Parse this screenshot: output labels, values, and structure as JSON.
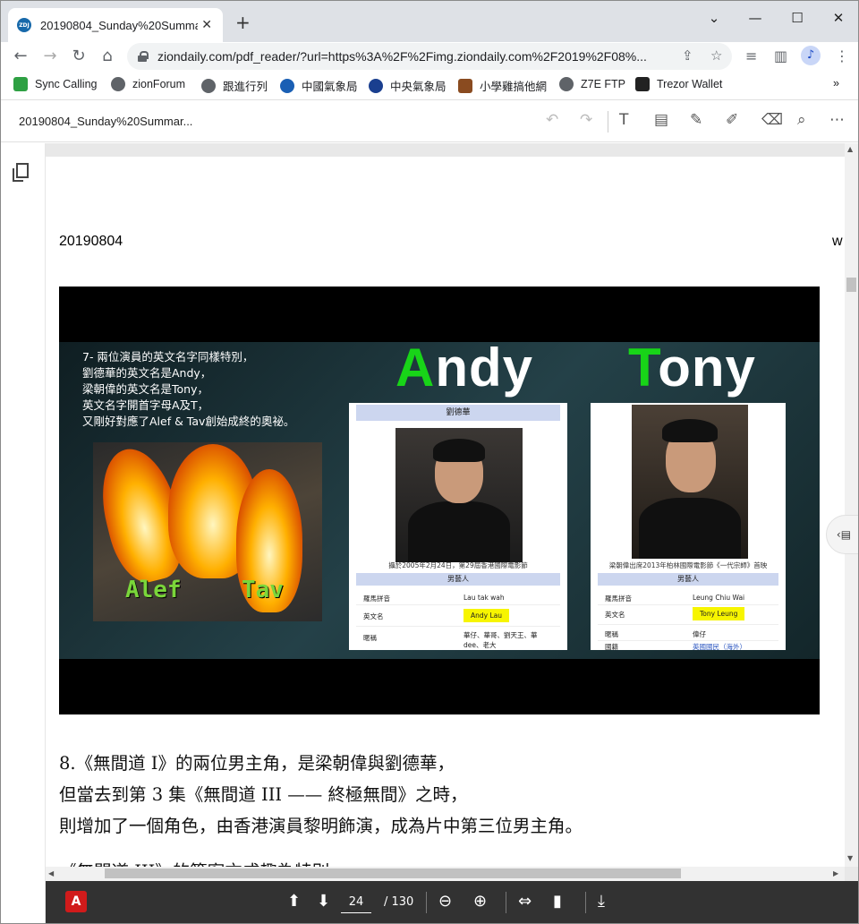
{
  "browser": {
    "tab_title": "20190804_Sunday%20Summar",
    "tab_favicon_text": "ZDJ",
    "url": "ziondaily.com/pdf_reader/?url=https%3A%2F%2Fimg.ziondaily.com%2F2019%2F08%...",
    "window_controls": {
      "minimize": "—",
      "maximize": "☐",
      "close": "✕"
    }
  },
  "bookmarks": [
    {
      "label": "Sync Calling",
      "icon": "sync-calling-icon",
      "color": "#2ea043"
    },
    {
      "label": "zionForum",
      "icon": "globe-icon",
      "color": "#5f6368"
    },
    {
      "label": "跟進行列",
      "icon": "globe-icon",
      "color": "#5f6368"
    },
    {
      "label": "中國氣象局",
      "icon": "cma-icon",
      "color": "#1a5fb4"
    },
    {
      "label": "中央氣象局",
      "icon": "cwb-icon",
      "color": "#1a3f8f"
    },
    {
      "label": "小學雞搞他網",
      "icon": "game-icon",
      "color": "#8a4b20"
    },
    {
      "label": "Z7E FTP",
      "icon": "globe-icon",
      "color": "#5f6368"
    },
    {
      "label": "Trezor Wallet",
      "icon": "lock-icon",
      "color": "#222"
    }
  ],
  "pdf": {
    "filename": "20190804_Sunday%20Summar...",
    "date_text": "20190804",
    "right_char": "w",
    "slide": {
      "text": "7- 兩位演員的英文名字同樣特別，\n劉德華的英文名是Andy，\n梁朝偉的英文名是Tony，\n英文名字開首字母A及T，\n又剛好對應了Alef & Tav創始成終的奧祕。",
      "alef_label": "Alef",
      "tav_label": "Tav",
      "andy_first": "A",
      "andy_rest": "ndy",
      "tony_first": "T",
      "tony_rest": "ony",
      "card_left": {
        "header": "劉德華",
        "caption": "攝於2005年2月24日，第29屆香港國際電影節",
        "section": "男藝人",
        "rows": [
          {
            "k": "羅馬拼音",
            "v": "Lau tak wah"
          },
          {
            "k": "英文名",
            "v": "Andy Lau"
          },
          {
            "k": "暱稱",
            "v": "華仔、華哥、劉天王、華dee、老大"
          }
        ]
      },
      "card_right": {
        "caption": "梁朝偉出席2013年柏林國際電影節《一代宗師》首映",
        "section": "男藝人",
        "rows": [
          {
            "k": "羅馬拼音",
            "v": "Leung Chiu Wai"
          },
          {
            "k": "英文名",
            "v": "Tony Leung"
          },
          {
            "k": "暱稱",
            "v": "偉仔"
          },
          {
            "k": "國籍",
            "v": "英國國民（海外）"
          }
        ]
      }
    },
    "paragraph": "8.《無間道 I》的兩位男主角，是梁朝偉與劉德華，\n但當去到第 3 集《無間道 III —— 終極無間》之時，\n則增加了一個角色，由香港演員黎明飾演，成為片中第三位男主角。",
    "paragraph_cut": "《無間道 III》的簡寫亦成趣為特別"
  },
  "bottom": {
    "page": "24",
    "total": "/ 130"
  }
}
